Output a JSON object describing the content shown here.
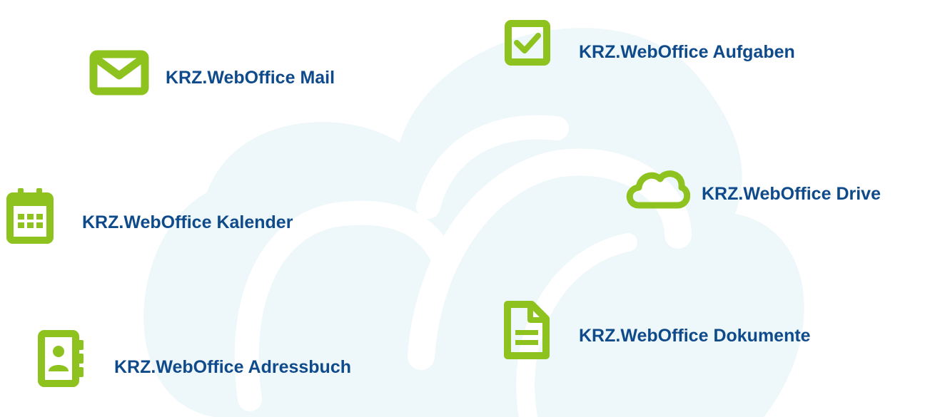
{
  "colors": {
    "label": "#0f4a8a",
    "icon": "#8dc21f",
    "cloud_background": "#eef7f9"
  },
  "features": {
    "mail": {
      "label": "KRZ.WebOffice Mail",
      "icon": "envelope-icon"
    },
    "tasks": {
      "label": "KRZ.WebOffice Aufgaben",
      "icon": "checkbox-icon"
    },
    "calendar": {
      "label": "KRZ.WebOffice Kalender",
      "icon": "calendar-icon"
    },
    "drive": {
      "label": "KRZ.WebOffice Drive",
      "icon": "cloud-icon"
    },
    "addressbook": {
      "label": "KRZ.WebOffice Adressbuch",
      "icon": "address-book-icon"
    },
    "documents": {
      "label": "KRZ.WebOffice Dokumente",
      "icon": "document-icon"
    }
  }
}
